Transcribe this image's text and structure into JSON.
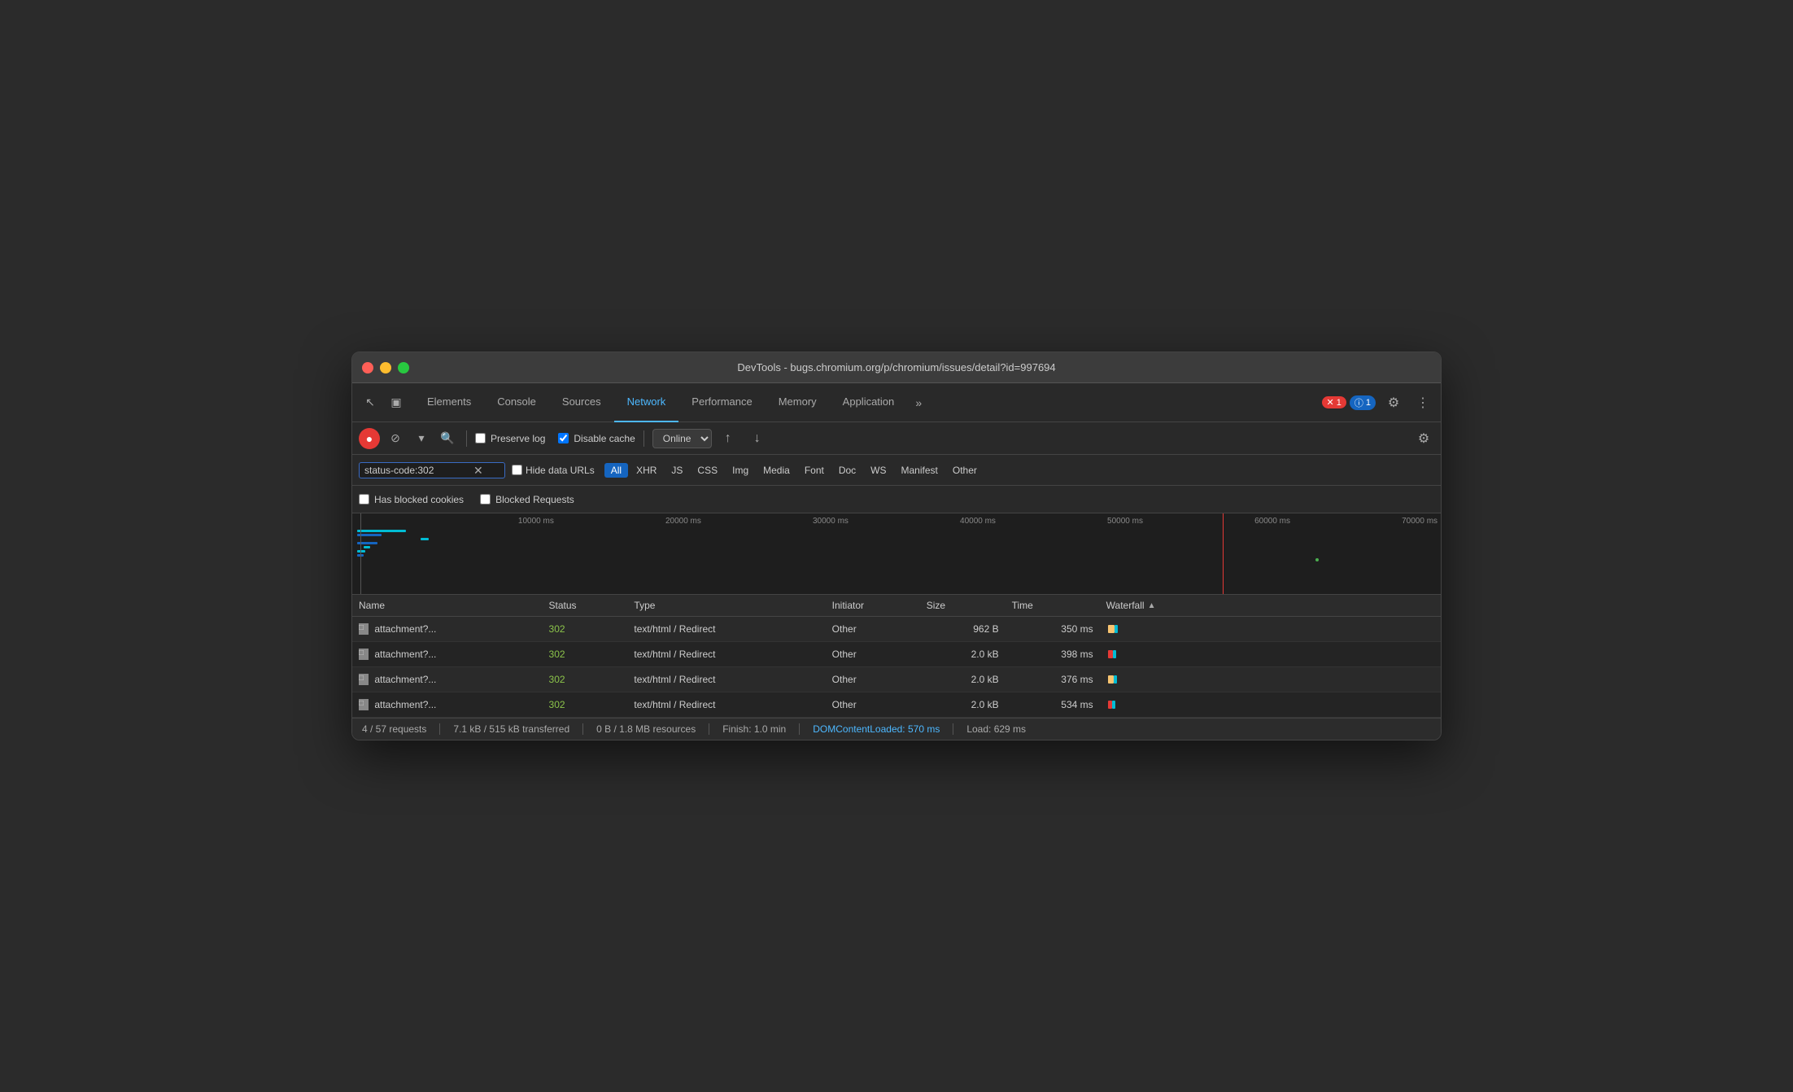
{
  "window": {
    "title": "DevTools - bugs.chromium.org/p/chromium/issues/detail?id=997694"
  },
  "tabs": [
    {
      "label": "Elements",
      "active": false
    },
    {
      "label": "Console",
      "active": false
    },
    {
      "label": "Sources",
      "active": false
    },
    {
      "label": "Network",
      "active": true
    },
    {
      "label": "Performance",
      "active": false
    },
    {
      "label": "Memory",
      "active": false
    },
    {
      "label": "Application",
      "active": false
    }
  ],
  "toolbar": {
    "preserve_log_label": "Preserve log",
    "disable_cache_label": "Disable cache",
    "online_label": "Online",
    "preserve_log_checked": false,
    "disable_cache_checked": true
  },
  "filter": {
    "search_value": "status-code:302",
    "hide_data_urls_label": "Hide data URLs",
    "all_label": "All",
    "types": [
      "XHR",
      "JS",
      "CSS",
      "Img",
      "Media",
      "Font",
      "Doc",
      "WS",
      "Manifest",
      "Other"
    ],
    "active_type": "All"
  },
  "checkbox_filters": {
    "has_blocked_cookies": "Has blocked cookies",
    "blocked_requests": "Blocked Requests"
  },
  "timeline": {
    "labels": [
      "10000 ms",
      "20000 ms",
      "30000 ms",
      "40000 ms",
      "50000 ms",
      "60000 ms",
      "70000 ms"
    ]
  },
  "table": {
    "headers": [
      "Name",
      "Status",
      "Type",
      "Initiator",
      "Size",
      "Time",
      "Waterfall"
    ],
    "rows": [
      {
        "name": "attachment?...",
        "status": "302",
        "type": "text/html / Redirect",
        "initiator": "Other",
        "size": "962 B",
        "time": "350 ms"
      },
      {
        "name": "attachment?...",
        "status": "302",
        "type": "text/html / Redirect",
        "initiator": "Other",
        "size": "2.0 kB",
        "time": "398 ms"
      },
      {
        "name": "attachment?...",
        "status": "302",
        "type": "text/html / Redirect",
        "initiator": "Other",
        "size": "2.0 kB",
        "time": "376 ms"
      },
      {
        "name": "attachment?...",
        "status": "302",
        "type": "text/html / Redirect",
        "initiator": "Other",
        "size": "2.0 kB",
        "time": "534 ms"
      }
    ]
  },
  "status_bar": {
    "requests": "4 / 57 requests",
    "transferred": "7.1 kB / 515 kB transferred",
    "resources": "0 B / 1.8 MB resources",
    "finish": "Finish: 1.0 min",
    "dom_loaded": "DOMContentLoaded: 570 ms",
    "load": "Load: 629 ms"
  },
  "badges": {
    "error_count": "1",
    "warn_count": "1"
  },
  "icons": {
    "cursor": "↖",
    "device": "▣",
    "more": "»",
    "settings": "⚙",
    "overflow": "⋮",
    "record": "●",
    "stop": "⊘",
    "filter": "▾",
    "search": "🔍",
    "upload": "↑",
    "download": "↓",
    "gear": "⚙",
    "clear": "✕",
    "sort_up": "▲"
  }
}
